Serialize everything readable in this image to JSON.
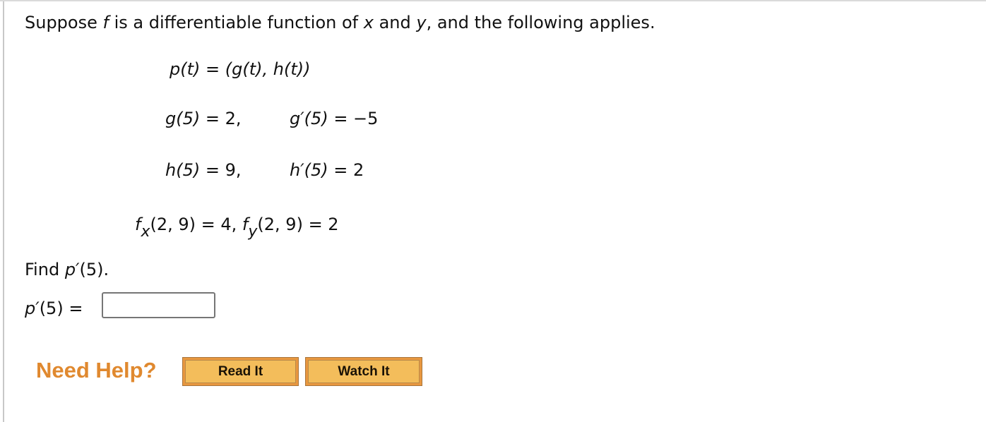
{
  "intro": {
    "part1": "Suppose ",
    "f": "f",
    "part2": " is a differentiable function of ",
    "x": "x",
    "part3": " and ",
    "y": "y",
    "part4": ", and the following applies."
  },
  "equations": {
    "p_def": {
      "lhs": "p(t)",
      "eq": " = ",
      "rhs": "(g(t), h(t))"
    },
    "g_values": {
      "lhs1": "g(5)",
      "rhs1": " = 2,",
      "lhs2": "g′(5)",
      "rhs2": " = −5"
    },
    "h_values": {
      "lhs1": "h(5)",
      "rhs1": " = 9,",
      "lhs2": "h′(5)",
      "rhs2": " = 2"
    },
    "partials": {
      "fx_f": "f",
      "fx_sub": "x",
      "fx_args": "(2, 9)",
      "fx_rhs": " = 4, ",
      "fy_f": "f",
      "fy_sub": "y",
      "fy_args": "(2, 9)",
      "fy_rhs": " = 2"
    }
  },
  "question": {
    "find_prefix": "Find ",
    "find_target": "p′",
    "find_suffix": "(5).",
    "answer_label_var": "p′",
    "answer_label_rest": "(5) = ",
    "answer_value": ""
  },
  "help": {
    "label": "Need Help?",
    "read_it": "Read It",
    "watch_it": "Watch It"
  }
}
